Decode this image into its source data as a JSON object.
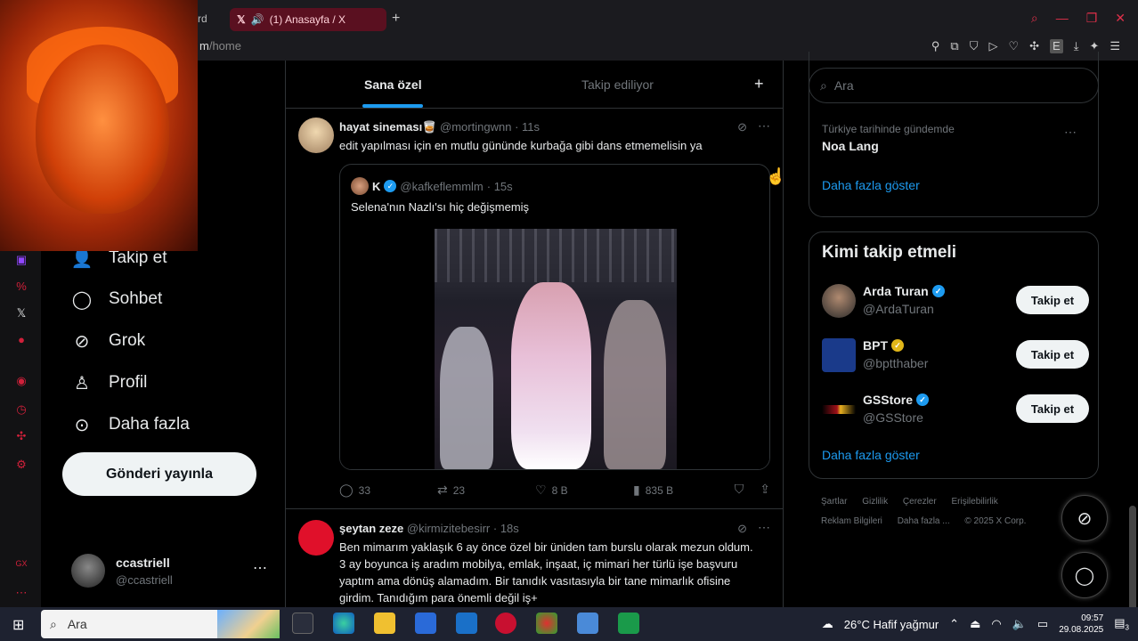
{
  "browser": {
    "prev_tab_label": "rd",
    "active_tab_label": "(1) Anasayfa / X",
    "url_domain": "m",
    "url_path": "/home",
    "new_tab_symbol": "+"
  },
  "nav": {
    "items": [
      {
        "label": "Takip et",
        "icon": "add-user-icon"
      },
      {
        "label": "Sohbet",
        "icon": "chat-icon"
      },
      {
        "label": "Grok",
        "icon": "grok-icon"
      },
      {
        "label": "Profil",
        "icon": "profile-icon"
      },
      {
        "label": "Daha fazla",
        "icon": "more-circle-icon"
      }
    ],
    "post_button": "Gönderi yayınla",
    "account": {
      "name": "ccastriell",
      "handle": "@ccastriell"
    }
  },
  "feed": {
    "tabs": [
      "Sana özel",
      "Takip ediliyor"
    ],
    "tweets": [
      {
        "name": "hayat sineması🥃",
        "handle": "@mortingwnn",
        "time": "· 11s",
        "text": "edit yapılması için en mutlu gününde kurbağa gibi dans etmemelisin ya",
        "quote": {
          "name": "K",
          "handle": "@kafkeflemmlm",
          "time": "· 15s",
          "text": "Selena'nın Nazlı'sı hiç değişmemiş"
        },
        "stats": {
          "replies": "33",
          "reposts": "23",
          "likes": "8 B",
          "views": "835 B"
        }
      },
      {
        "name": "şeytan zeze",
        "handle": "@kirmizitebesirr",
        "time": "· 18s",
        "text": "Ben mimarım yaklaşık 6 ay önce özel bir üniden tam burslu olarak mezun oldum. 3 ay boyunca iş aradım mobilya, emlak, inşaat, iç mimari her türlü işe başvuru yaptım ama dönüş alamadım. Bir tanıdık vasıtasıyla bir tane mimarlık ofisine girdim. Tanıdığım para önemli değil iş+"
      }
    ]
  },
  "sidebar": {
    "search_placeholder": "Ara",
    "trend": {
      "category": "Türkiye tarihinde gündemde",
      "name": "Noa Lang"
    },
    "show_more": "Daha fazla göster",
    "who_to_follow": {
      "title": "Kimi takip etmeli",
      "accounts": [
        {
          "name": "Arda Turan",
          "handle": "@ArdaTuran",
          "badge": "blue"
        },
        {
          "name": "BPT",
          "handle": "@bptthaber",
          "badge": "gold"
        },
        {
          "name": "GSStore",
          "handle": "@GSStore",
          "badge": "blue"
        }
      ],
      "follow_label": "Takip et",
      "show_more": "Daha fazla göster"
    },
    "footer_line1": [
      "Şartlar",
      "Gizlilik",
      "Çerezler",
      "Erişilebilirlik"
    ],
    "footer_line2": [
      "Reklam Bilgileri",
      "Daha fazla ...",
      "© 2025 X Corp."
    ]
  },
  "taskbar": {
    "search_placeholder": "Ara",
    "weather": "26°C  Hafif yağmur",
    "time": "09:57",
    "date": "29.08.2025",
    "notif_count": "3"
  },
  "colors": {
    "accent": "#1d9bf0",
    "browser_accent": "#e0304a",
    "bg": "#000000"
  }
}
